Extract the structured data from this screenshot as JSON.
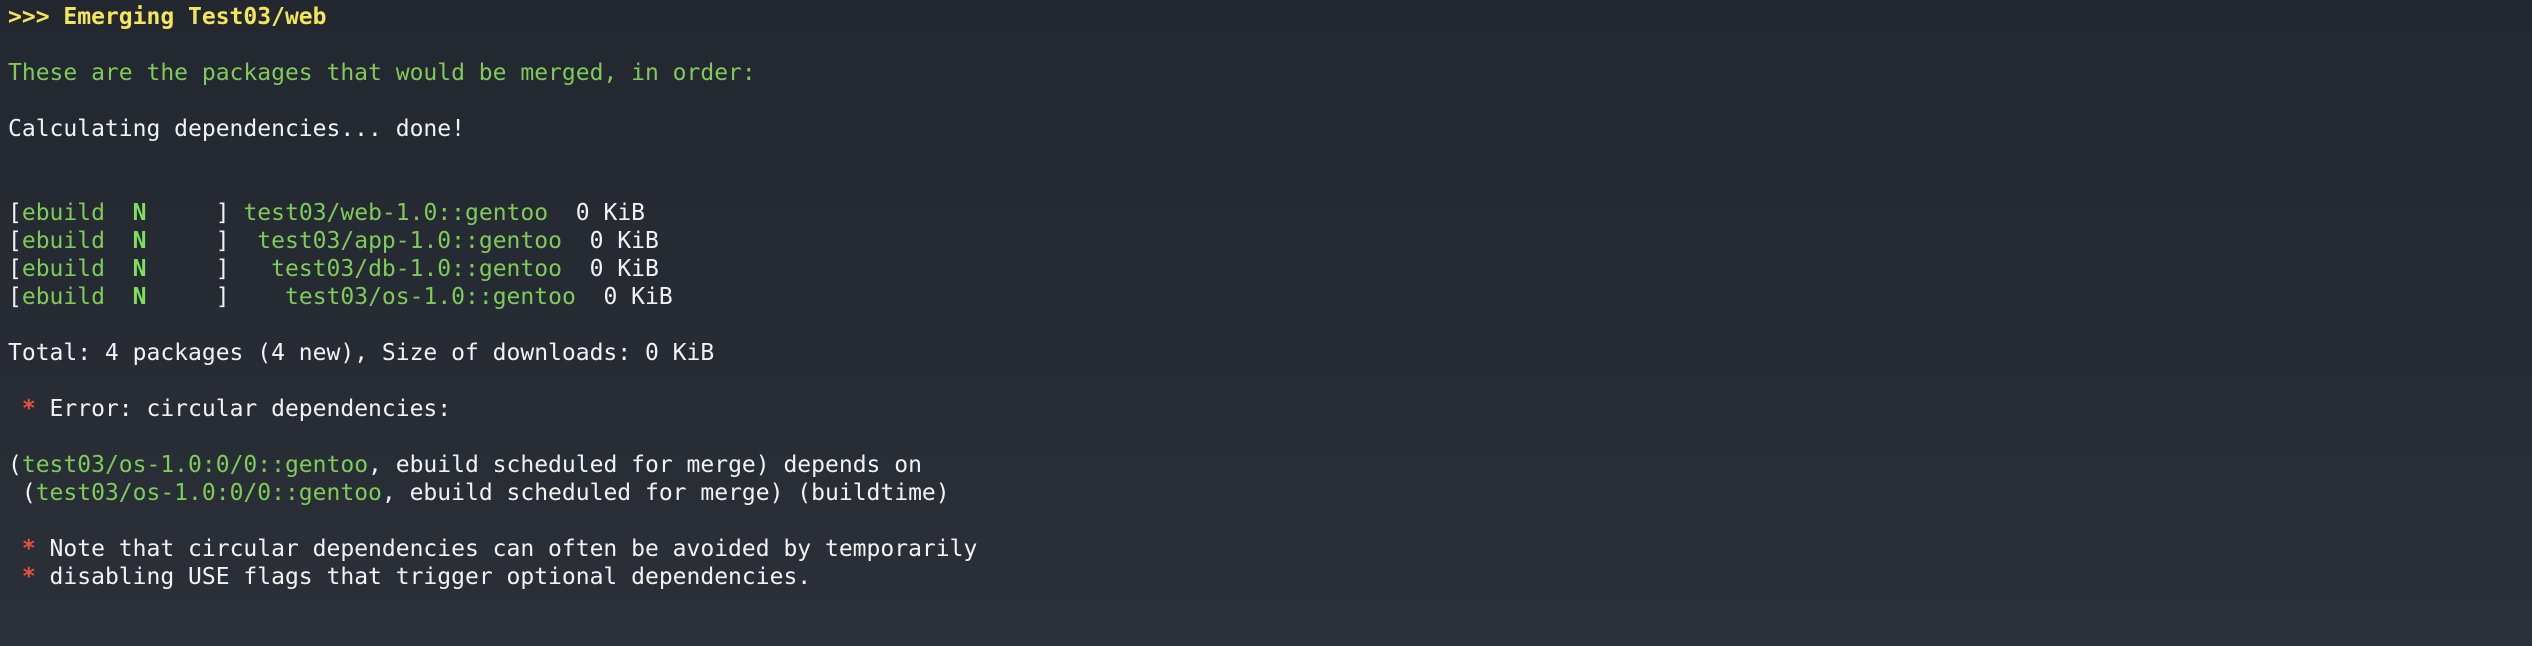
{
  "emerge_header": ">>> Emerging Test03/web",
  "merge_intro": "These are the packages that would be merged, in order:",
  "calculating": "Calculating dependencies... done!",
  "packages": [
    {
      "open": "[",
      "type": "ebuild",
      "flag": "N",
      "pad": "     ] ",
      "atom": "test03/web-1.0::gentoo",
      "size": "  0 KiB"
    },
    {
      "open": "[",
      "type": "ebuild",
      "flag": "N",
      "pad": "     ]  ",
      "atom": "test03/app-1.0::gentoo",
      "size": "  0 KiB"
    },
    {
      "open": "[",
      "type": "ebuild",
      "flag": "N",
      "pad": "     ]   ",
      "atom": "test03/db-1.0::gentoo",
      "size": "  0 KiB"
    },
    {
      "open": "[",
      "type": "ebuild",
      "flag": "N",
      "pad": "     ]    ",
      "atom": "test03/os-1.0::gentoo",
      "size": "  0 KiB"
    }
  ],
  "total": "Total: 4 packages (4 new), Size of downloads: 0 KiB",
  "error": {
    "star": " *",
    "text": " Error: circular dependencies:"
  },
  "dependency": {
    "line1_prefix": "(",
    "line1_atom": "test03/os-1.0:0/0::gentoo",
    "line1_suffix": ", ebuild scheduled for merge) depends on",
    "line2_prefix": " (",
    "line2_atom": "test03/os-1.0:0/0::gentoo",
    "line2_suffix": ", ebuild scheduled for merge) (buildtime)"
  },
  "note": {
    "star": " *",
    "line1": " Note that circular dependencies can often be avoided by temporarily",
    "line2": " disabling USE flags that trigger optional dependencies."
  },
  "colors": {
    "background": "#272c34",
    "header_yellow": "#f4e55b",
    "text_green": "#7ecb57",
    "flag_green": "#7ee05a",
    "error_red": "#e8523c",
    "text_white": "#f2f2f2"
  }
}
